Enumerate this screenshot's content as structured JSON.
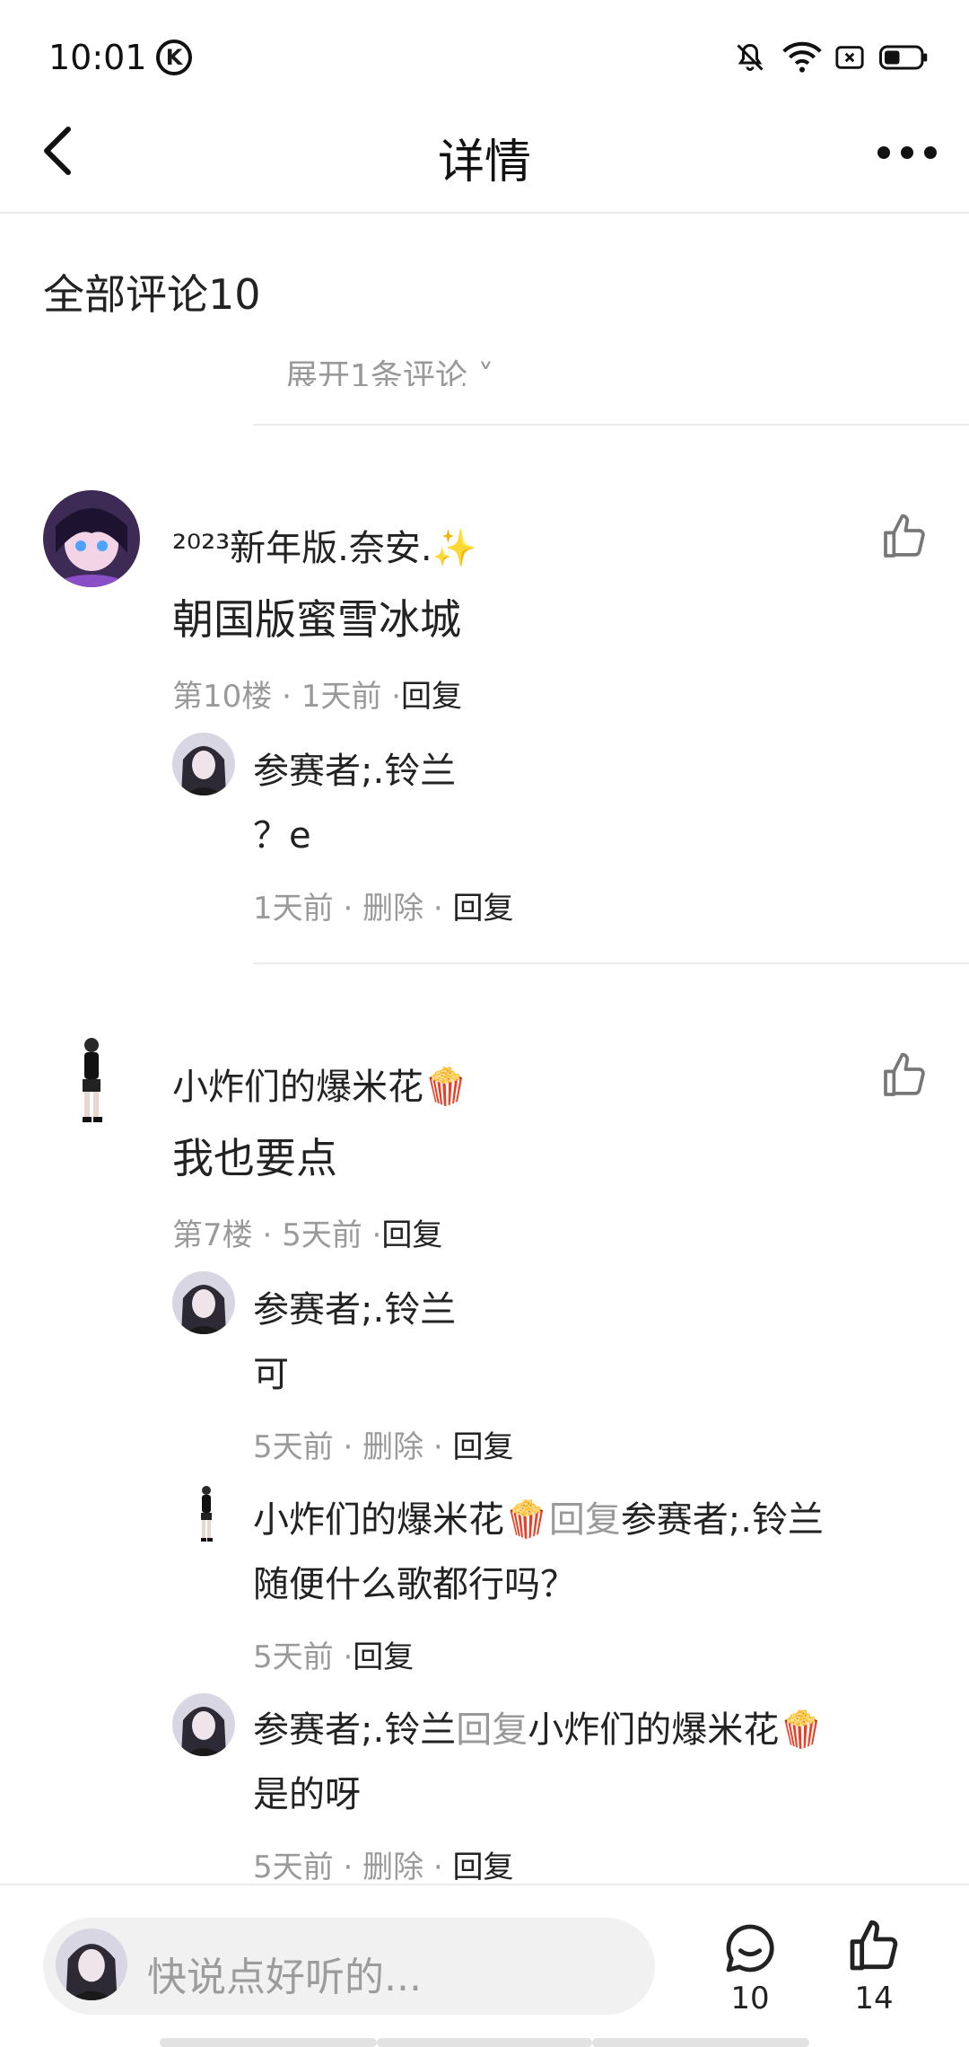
{
  "status_bar": {
    "time": "10:01",
    "k_badge": "K"
  },
  "header": {
    "title": "详情"
  },
  "comments": {
    "heading": "全部评论10",
    "expand_partial": "展开1条评论 ˅"
  },
  "threads": [
    {
      "author": "²⁰²³新年版.奈安.",
      "author_emoji": "✨",
      "content": "朝国版蜜雪冰城",
      "floor": "第10楼",
      "time": "1天前",
      "reply_label": "回复",
      "replies": [
        {
          "author": "参赛者;.铃兰",
          "content": "？e",
          "time": "1天前",
          "delete_label": "删除",
          "reply_label": "回复"
        }
      ]
    },
    {
      "author": "小炸们的爆米花",
      "author_emoji": "🍿",
      "content": "我也要点",
      "floor": "第7楼",
      "time": "5天前",
      "reply_label": "回复",
      "replies": [
        {
          "author": "参赛者;.铃兰",
          "content": "可",
          "time": "5天前",
          "delete_label": "删除",
          "reply_label": "回复"
        },
        {
          "author": "小炸们的爆米花",
          "author_emoji": "🍿",
          "reply_word": "回复",
          "target": "参赛者;.铃兰",
          "content": "随便什么歌都行吗？",
          "time": "5天前",
          "reply_label": "回复"
        },
        {
          "author": "参赛者;.铃兰",
          "reply_word": "回复",
          "target": "小炸们的爆米花",
          "target_emoji": "🍿",
          "content": "是的呀",
          "time": "5天前",
          "delete_label": "删除",
          "reply_label": "回复"
        }
      ]
    }
  ],
  "bottom_bar": {
    "placeholder": "快说点好听的...",
    "comment_count": "10",
    "like_count": "14"
  },
  "colors": {
    "text": "#222222",
    "meta": "#9a9a9a",
    "divider": "#ececec",
    "input_bg": "#f1f1f1"
  },
  "icons": [
    "back-arrow-icon",
    "more-dots-icon",
    "thumb-up-icon",
    "comment-bubble-icon",
    "mute-bell-icon",
    "wifi-icon",
    "sim-x-icon",
    "battery-icon"
  ]
}
